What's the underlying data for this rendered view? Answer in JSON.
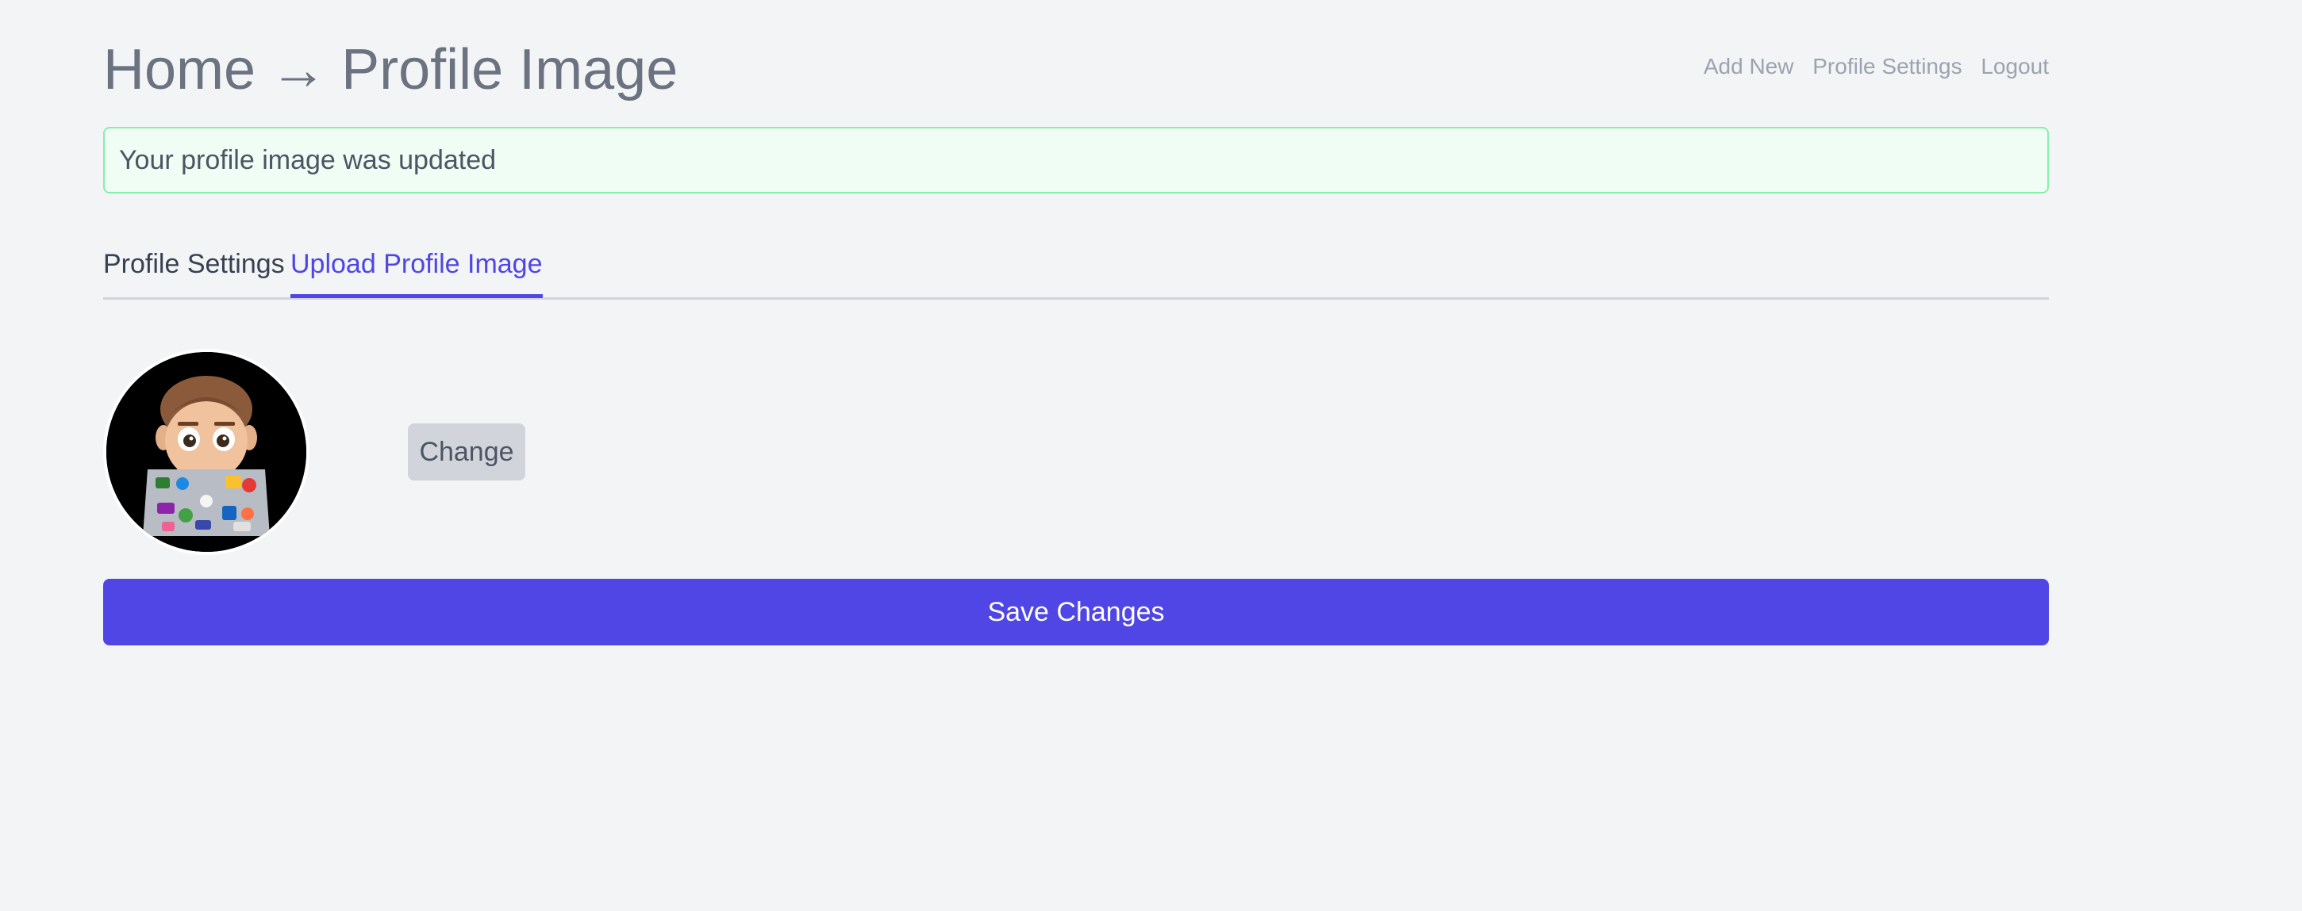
{
  "header": {
    "home": "Home",
    "arrow": "→",
    "current": "Profile Image"
  },
  "nav": {
    "add_new": "Add New",
    "profile_settings": "Profile Settings",
    "logout": "Logout"
  },
  "alert": {
    "message": "Your profile image was updated"
  },
  "tabs": [
    {
      "label": "Profile Settings",
      "active": false
    },
    {
      "label": "Upload Profile Image",
      "active": true
    }
  ],
  "profile": {
    "change_label": "Change",
    "avatar_icon": "memoji-laptop-avatar"
  },
  "actions": {
    "save_label": "Save Changes"
  },
  "colors": {
    "accent": "#4f46e5",
    "alert_bg": "#f0fdf4",
    "alert_border": "#86efac",
    "page_bg": "#f3f4f6"
  }
}
